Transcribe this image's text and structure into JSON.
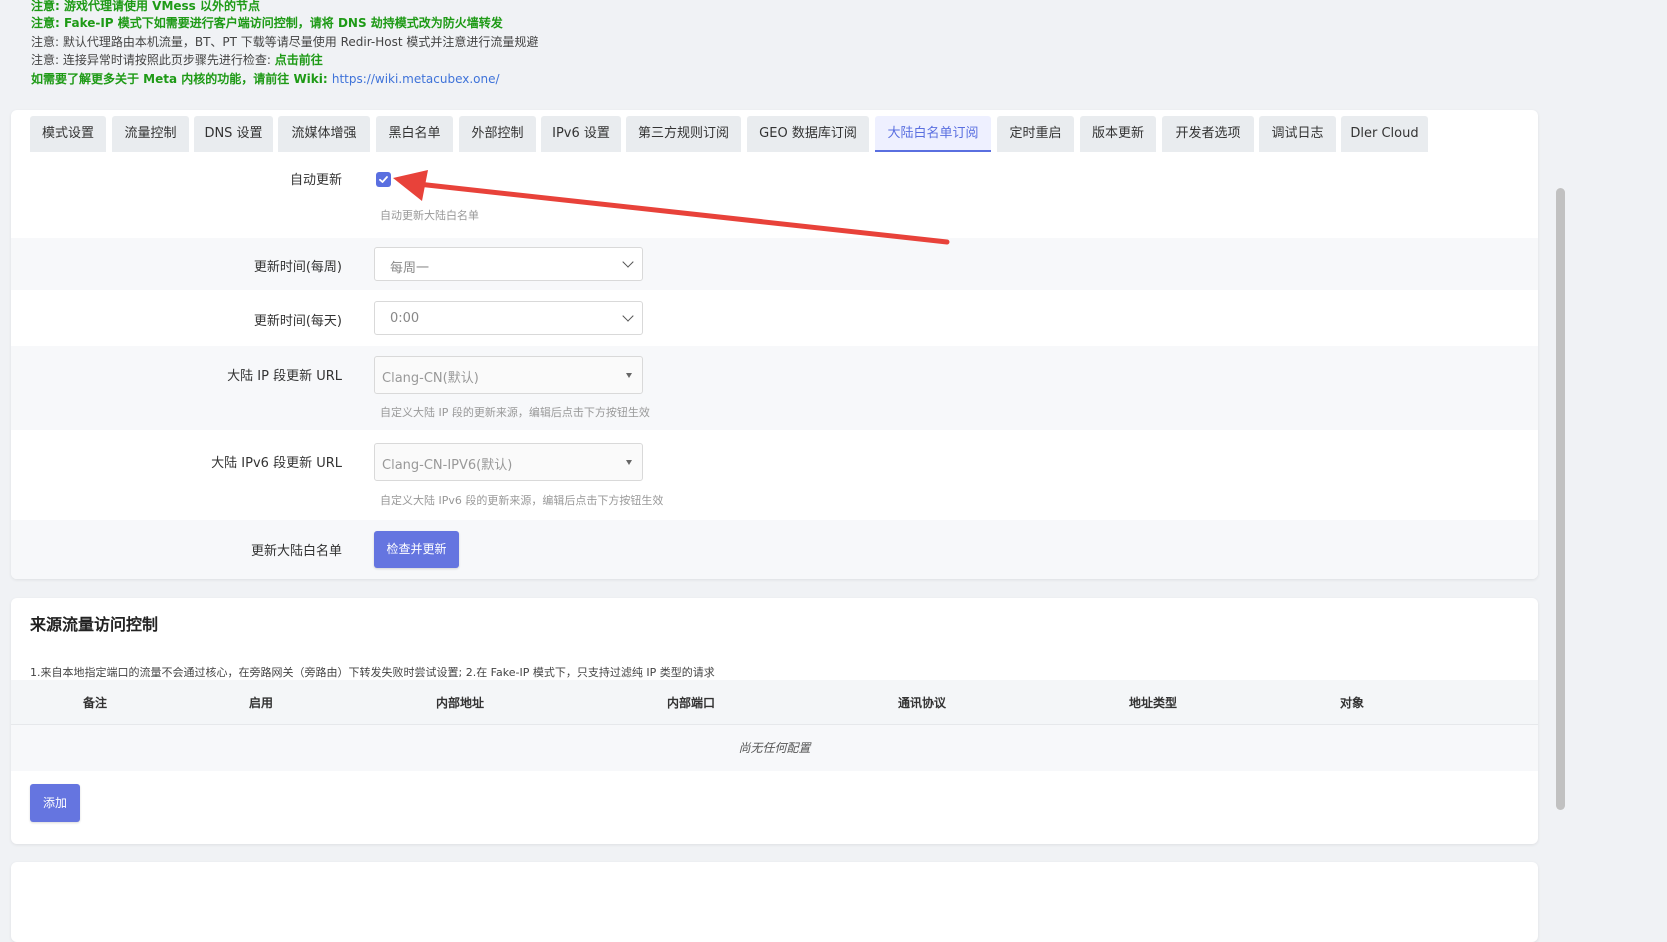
{
  "notices": [
    {
      "text": "注意: 游戏代理请使用 VMess 以外的节点",
      "style": "green"
    },
    {
      "text": "注意: Fake-IP 模式下如需要进行客户端访问控制，请将 DNS 劫持模式改为防火墙转发",
      "style": "green"
    },
    {
      "text": "注意: 默认代理路由本机流量，BT、PT 下载等请尽量使用 Redir-Host 模式并注意进行流量规避",
      "style": "plain"
    },
    {
      "text": "注意: 连接异常时请按照此页步骤先进行检查: ",
      "link": "点击前往",
      "style": "plain"
    },
    {
      "text": "如需要了解更多关于 Meta 内核的功能，请前往 Wiki: ",
      "link": "https://wiki.metacubex.one/",
      "style": "green"
    }
  ],
  "tabs": [
    {
      "label": "模式设置"
    },
    {
      "label": "流量控制"
    },
    {
      "label": "DNS 设置"
    },
    {
      "label": "流媒体增强"
    },
    {
      "label": "黑白名单"
    },
    {
      "label": "外部控制"
    },
    {
      "label": "IPv6 设置"
    },
    {
      "label": "第三方规则订阅"
    },
    {
      "label": "GEO 数据库订阅"
    },
    {
      "label": "大陆白名单订阅",
      "active": true
    },
    {
      "label": "定时重启"
    },
    {
      "label": "版本更新"
    },
    {
      "label": "开发者选项"
    },
    {
      "label": "调试日志"
    },
    {
      "label": "Dler Cloud"
    }
  ],
  "form": {
    "auto_update": {
      "label": "自动更新",
      "checked": true,
      "hint": "自动更新大陆白名单"
    },
    "weekly": {
      "label": "更新时间(每周)",
      "value": "每周一"
    },
    "daily": {
      "label": "更新时间(每天)",
      "value": "0:00"
    },
    "ip_url": {
      "label": "大陆 IP 段更新 URL",
      "value": "Clang-CN(默认)",
      "hint": "自定义大陆 IP 段的更新来源，编辑后点击下方按钮生效"
    },
    "ipv6_url": {
      "label": "大陆 IPv6 段更新 URL",
      "value": "Clang-CN-IPV6(默认)",
      "hint": "自定义大陆 IPv6 段的更新来源，编辑后点击下方按钮生效"
    },
    "update": {
      "label": "更新大陆白名单",
      "button": "检查并更新"
    }
  },
  "acl": {
    "title": "来源流量访问控制",
    "description": "1.来自本地指定端口的流量不会通过核心，在旁路网关（旁路由）下转发失败时尝试设置; 2.在 Fake-IP 模式下，只支持过滤纯 IP 类型的请求",
    "columns": [
      "备注",
      "启用",
      "内部地址",
      "内部端口",
      "通讯协议",
      "地址类型",
      "对象"
    ],
    "empty": "尚无任何配置",
    "add_button": "添加"
  },
  "colors": {
    "accent": "#5a6fe0",
    "notice_green": "#1e9a16",
    "arrow": "#e8423a"
  }
}
